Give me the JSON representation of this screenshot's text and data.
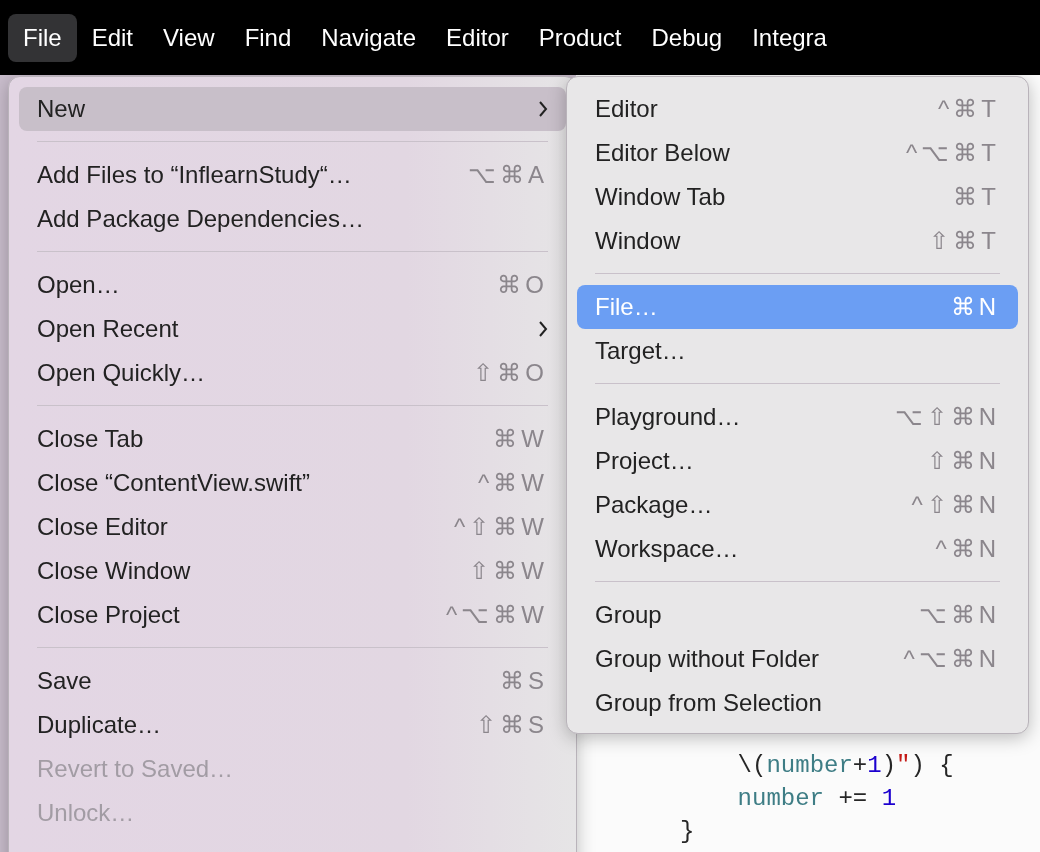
{
  "menu_bar": [
    {
      "label": "File",
      "selected": true
    },
    {
      "label": "Edit",
      "selected": false
    },
    {
      "label": "View",
      "selected": false
    },
    {
      "label": "Find",
      "selected": false
    },
    {
      "label": "Navigate",
      "selected": false
    },
    {
      "label": "Editor",
      "selected": false
    },
    {
      "label": "Product",
      "selected": false
    },
    {
      "label": "Debug",
      "selected": false
    },
    {
      "label": "Integra",
      "selected": false
    }
  ],
  "file_menu": [
    {
      "kind": "item",
      "label": "New",
      "submenu": true,
      "selected": true,
      "disabled": false
    },
    {
      "kind": "separator"
    },
    {
      "kind": "item",
      "label": "Add Files to “InflearnStudy“…",
      "shortcut": "⌥⌘A",
      "submenu": false,
      "selected": false,
      "disabled": false
    },
    {
      "kind": "item",
      "label": "Add Package Dependencies…",
      "submenu": false,
      "selected": false,
      "disabled": false
    },
    {
      "kind": "separator"
    },
    {
      "kind": "item",
      "label": "Open…",
      "shortcut": "⌘O",
      "submenu": false,
      "selected": false,
      "disabled": false
    },
    {
      "kind": "item",
      "label": "Open Recent",
      "submenu": true,
      "selected": false,
      "disabled": false
    },
    {
      "kind": "item",
      "label": "Open Quickly…",
      "shortcut": "⇧⌘O",
      "submenu": false,
      "selected": false,
      "disabled": false
    },
    {
      "kind": "separator"
    },
    {
      "kind": "item",
      "label": "Close Tab",
      "shortcut": "⌘W",
      "submenu": false,
      "selected": false,
      "disabled": false
    },
    {
      "kind": "item",
      "label": "Close “ContentView.swift”",
      "shortcut": "^⌘W",
      "submenu": false,
      "selected": false,
      "disabled": false
    },
    {
      "kind": "item",
      "label": "Close Editor",
      "shortcut": "^⇧⌘W",
      "submenu": false,
      "selected": false,
      "disabled": false
    },
    {
      "kind": "item",
      "label": "Close Window",
      "shortcut": "⇧⌘W",
      "submenu": false,
      "selected": false,
      "disabled": false
    },
    {
      "kind": "item",
      "label": "Close Project",
      "shortcut": "^⌥⌘W",
      "submenu": false,
      "selected": false,
      "disabled": false
    },
    {
      "kind": "separator"
    },
    {
      "kind": "item",
      "label": "Save",
      "shortcut": "⌘S",
      "submenu": false,
      "selected": false,
      "disabled": false
    },
    {
      "kind": "item",
      "label": "Duplicate…",
      "shortcut": "⇧⌘S",
      "submenu": false,
      "selected": false,
      "disabled": false
    },
    {
      "kind": "item",
      "label": "Revert to Saved…",
      "submenu": false,
      "selected": false,
      "disabled": true
    },
    {
      "kind": "item",
      "label": "Unlock…",
      "submenu": false,
      "selected": false,
      "disabled": true
    }
  ],
  "new_submenu": [
    {
      "kind": "item",
      "label": "Editor",
      "shortcut": "^⌘T",
      "selected": false
    },
    {
      "kind": "item",
      "label": "Editor Below",
      "shortcut": "^⌥⌘T",
      "selected": false
    },
    {
      "kind": "item",
      "label": "Window Tab",
      "shortcut": "⌘T",
      "selected": false
    },
    {
      "kind": "item",
      "label": "Window",
      "shortcut": "⇧⌘T",
      "selected": false
    },
    {
      "kind": "separator"
    },
    {
      "kind": "item",
      "label": "File…",
      "shortcut": "⌘N",
      "selected": true
    },
    {
      "kind": "item",
      "label": "Target…",
      "selected": false
    },
    {
      "kind": "separator"
    },
    {
      "kind": "item",
      "label": "Playground…",
      "shortcut": "⌥⇧⌘N",
      "selected": false
    },
    {
      "kind": "item",
      "label": "Project…",
      "shortcut": "⇧⌘N",
      "selected": false
    },
    {
      "kind": "item",
      "label": "Package…",
      "shortcut": "^⇧⌘N",
      "selected": false
    },
    {
      "kind": "item",
      "label": "Workspace…",
      "shortcut": "^⌘N",
      "selected": false
    },
    {
      "kind": "separator"
    },
    {
      "kind": "item",
      "label": "Group",
      "shortcut": "⌥⌘N",
      "selected": false
    },
    {
      "kind": "item",
      "label": "Group without Folder",
      "shortcut": "^⌥⌘N",
      "selected": false
    },
    {
      "kind": "item",
      "label": "Group from Selection",
      "selected": false
    }
  ],
  "code_lines": [
    [
      {
        "kind": "plain",
        "text": "    \\("
      },
      {
        "kind": "var",
        "text": "number"
      },
      {
        "kind": "plain",
        "text": "+"
      },
      {
        "kind": "num",
        "text": "1"
      },
      {
        "kind": "plain",
        "text": ")"
      },
      {
        "kind": "str",
        "text": "\""
      },
      {
        "kind": "plain",
        "text": ") {"
      }
    ],
    [
      {
        "kind": "var",
        "text": "    number"
      },
      {
        "kind": "plain",
        "text": " += "
      },
      {
        "kind": "num",
        "text": "1"
      }
    ],
    [
      {
        "kind": "plain",
        "text": "}"
      }
    ]
  ]
}
